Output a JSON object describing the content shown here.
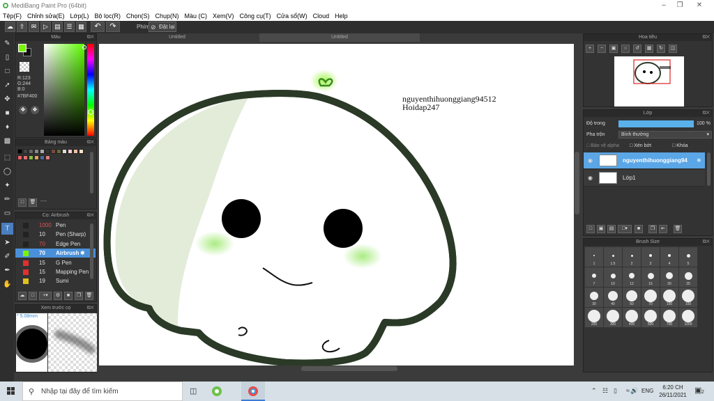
{
  "window": {
    "title": "MediBang Paint Pro (64bit)"
  },
  "menu": [
    "Tệp(F)",
    "Chỉnh sửa(E)",
    "Lớp(L)",
    "Bộ lọc(R)",
    "Chọn(S)",
    "Chụp(N)",
    "Màu (C)",
    "Xem(V)",
    "Công cụ(T)",
    "Cửa sổ(W)",
    "Cloud",
    "Help"
  ],
  "toolbar": {
    "label": "Phím",
    "reset": "Đặt lại"
  },
  "color_panel": {
    "title": "Màu",
    "fg_color": "#7BF400",
    "r": "R:123",
    "g": "G:244",
    "b": "B:0",
    "hex": "#7BF400"
  },
  "palette_panel": {
    "title": "Bảng màu",
    "footer": "----"
  },
  "brush_panel": {
    "title": "Cọ: Airbrush",
    "brushes": [
      {
        "size": "1000",
        "name": "Pen",
        "color": "#222222"
      },
      {
        "size": "10",
        "name": "Pen (Sharp)",
        "color": "#222222"
      },
      {
        "size": "70",
        "name": "Edge Pen",
        "color": "#222222"
      },
      {
        "size": "70",
        "name": "Airbrush",
        "color": "#7bf400"
      },
      {
        "size": "15",
        "name": "G Pen",
        "color": "#e03030"
      },
      {
        "size": "15",
        "name": "Mapping Pen",
        "color": "#e03030"
      },
      {
        "size": "19",
        "name": "Sumi",
        "color": "#e0c020"
      }
    ]
  },
  "preview_panel": {
    "title": "Xem trước cọ",
    "size": "* 5.08mm"
  },
  "tabs": [
    "Untitled",
    "Untitled"
  ],
  "canvas": {
    "text_line1": "nguyenthihuonggiang94512",
    "text_line2": "Hoidap247"
  },
  "navigator": {
    "title": "Hoa tiêu"
  },
  "layer_panel": {
    "title": "Lớp",
    "opacity_label": "Độ trong",
    "opacity_value": "100 %",
    "opacity_pct": 100,
    "blend_label": "Pha trộn",
    "blend_value": "Bình thường",
    "protect_alpha": "Bảo vệ alpha",
    "clipping": "Xén bớt",
    "lock": "Khóa",
    "layers": [
      {
        "name": "nguyenthihuonggiang94",
        "selected": true
      },
      {
        "name": "Lớp1",
        "selected": false
      }
    ]
  },
  "brush_size": {
    "title": "Brush Size",
    "sizes": [
      "1",
      "1.5",
      "2",
      "3",
      "4",
      "5",
      "7",
      "10",
      "12",
      "15",
      "20",
      "25",
      "30",
      "40",
      "50",
      "70",
      "100",
      "150",
      "200",
      "300",
      "400",
      "500",
      "700",
      "1000"
    ]
  },
  "taskbar": {
    "search": "Nhập tại đây để tìm kiếm",
    "lang": "ENG",
    "time": "6:20 CH",
    "date": "26/11/2021",
    "notif_count": "2"
  }
}
